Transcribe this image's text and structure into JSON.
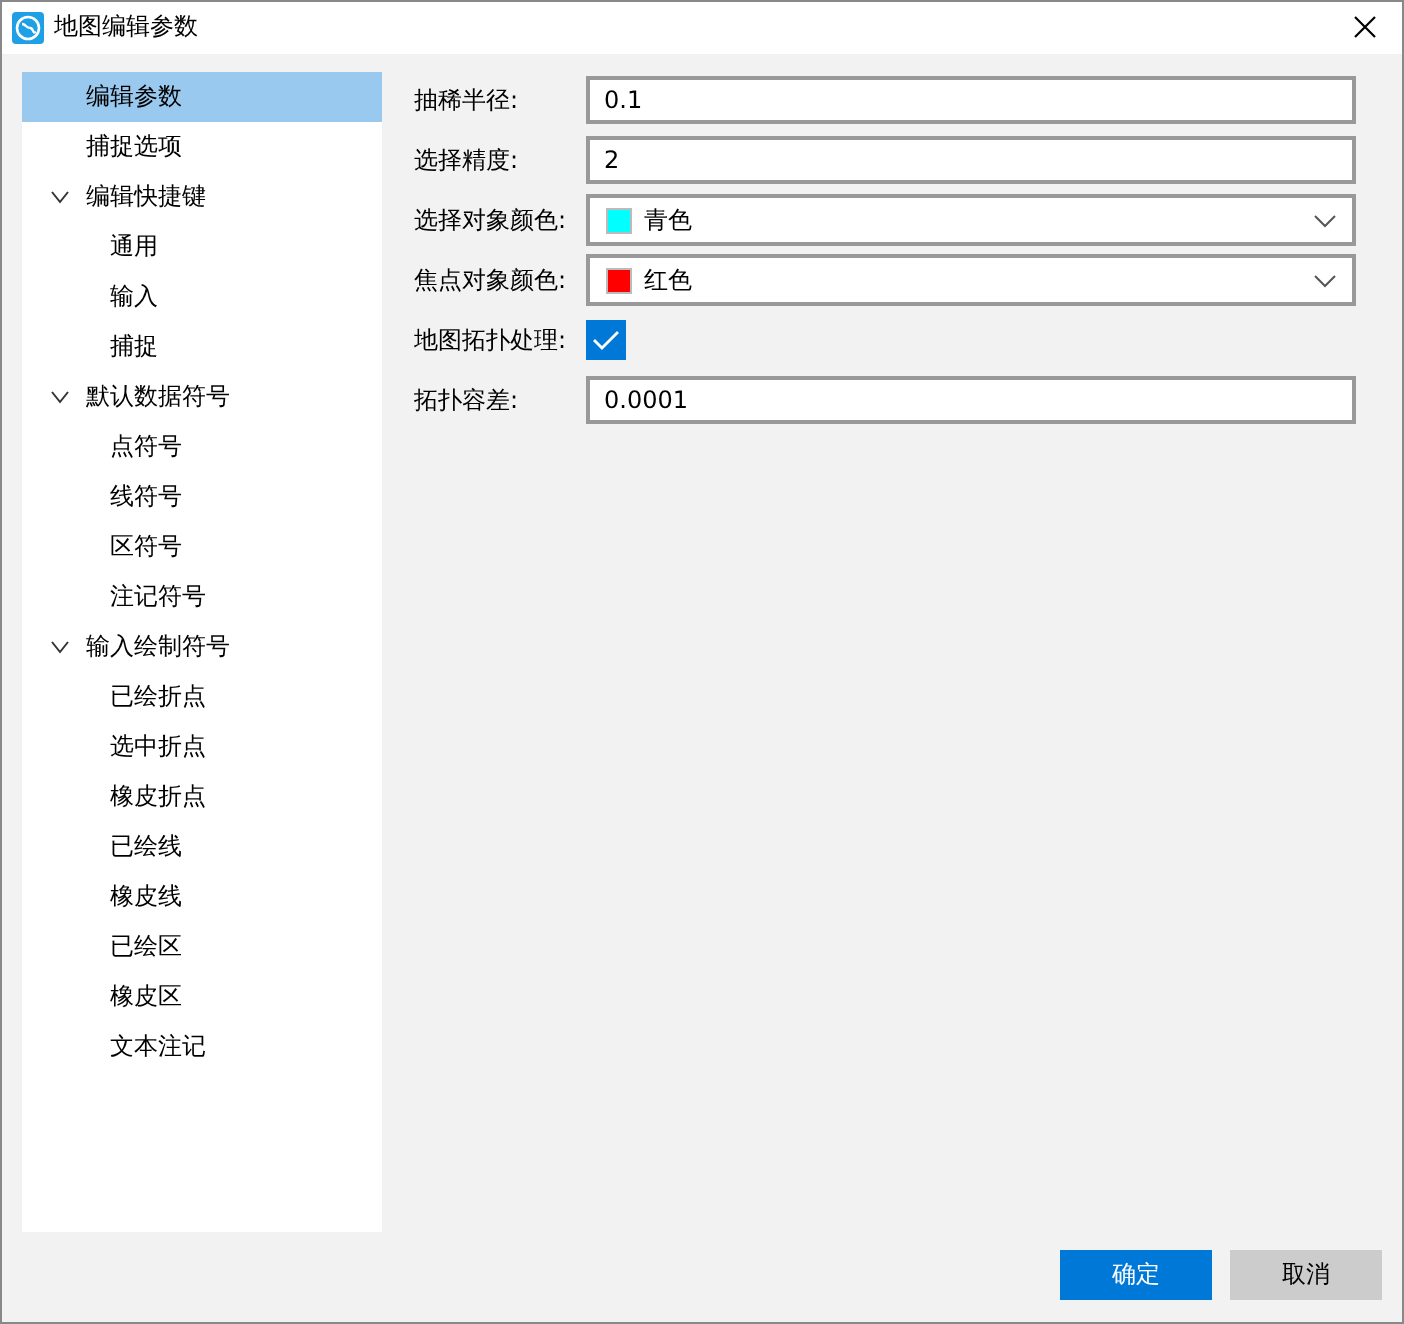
{
  "window": {
    "title": "地图编辑参数"
  },
  "tree": [
    {
      "label": "编辑参数",
      "selected": true
    },
    {
      "label": "捕捉选项",
      "selected": false
    },
    {
      "label": "编辑快捷键",
      "selected": false,
      "expanded": true,
      "children": [
        {
          "label": "通用",
          "selected": false
        },
        {
          "label": "输入",
          "selected": false
        },
        {
          "label": "捕捉",
          "selected": false
        }
      ]
    },
    {
      "label": "默认数据符号",
      "selected": false,
      "expanded": true,
      "children": [
        {
          "label": "点符号",
          "selected": false
        },
        {
          "label": "线符号",
          "selected": false
        },
        {
          "label": "区符号",
          "selected": false
        },
        {
          "label": "注记符号",
          "selected": false
        }
      ]
    },
    {
      "label": "输入绘制符号",
      "selected": false,
      "expanded": true,
      "children": [
        {
          "label": "已绘折点",
          "selected": false
        },
        {
          "label": "选中折点",
          "selected": false
        },
        {
          "label": "橡皮折点",
          "selected": false
        },
        {
          "label": "已绘线",
          "selected": false
        },
        {
          "label": "橡皮线",
          "selected": false
        },
        {
          "label": "已绘区",
          "selected": false
        },
        {
          "label": "橡皮区",
          "selected": false
        },
        {
          "label": "文本注记",
          "selected": false
        }
      ]
    }
  ],
  "fields": [
    {
      "kind": "text",
      "label": "抽稀半径:",
      "value": "0.1"
    },
    {
      "kind": "text",
      "label": "选择精度:",
      "value": "2"
    },
    {
      "kind": "dropdown",
      "label": "选择对象颜色:",
      "value": "青色",
      "color": "#00ffff"
    },
    {
      "kind": "dropdown",
      "label": "焦点对象颜色:",
      "value": "红色",
      "color": "#ff0000"
    },
    {
      "kind": "checkbox",
      "label": "地图拓扑处理:",
      "checked": true
    },
    {
      "kind": "text",
      "label": "拓扑容差:",
      "value": "0.0001"
    }
  ],
  "buttons": [
    {
      "label": "确定",
      "primary": true
    },
    {
      "label": "取消",
      "primary": false
    }
  ]
}
